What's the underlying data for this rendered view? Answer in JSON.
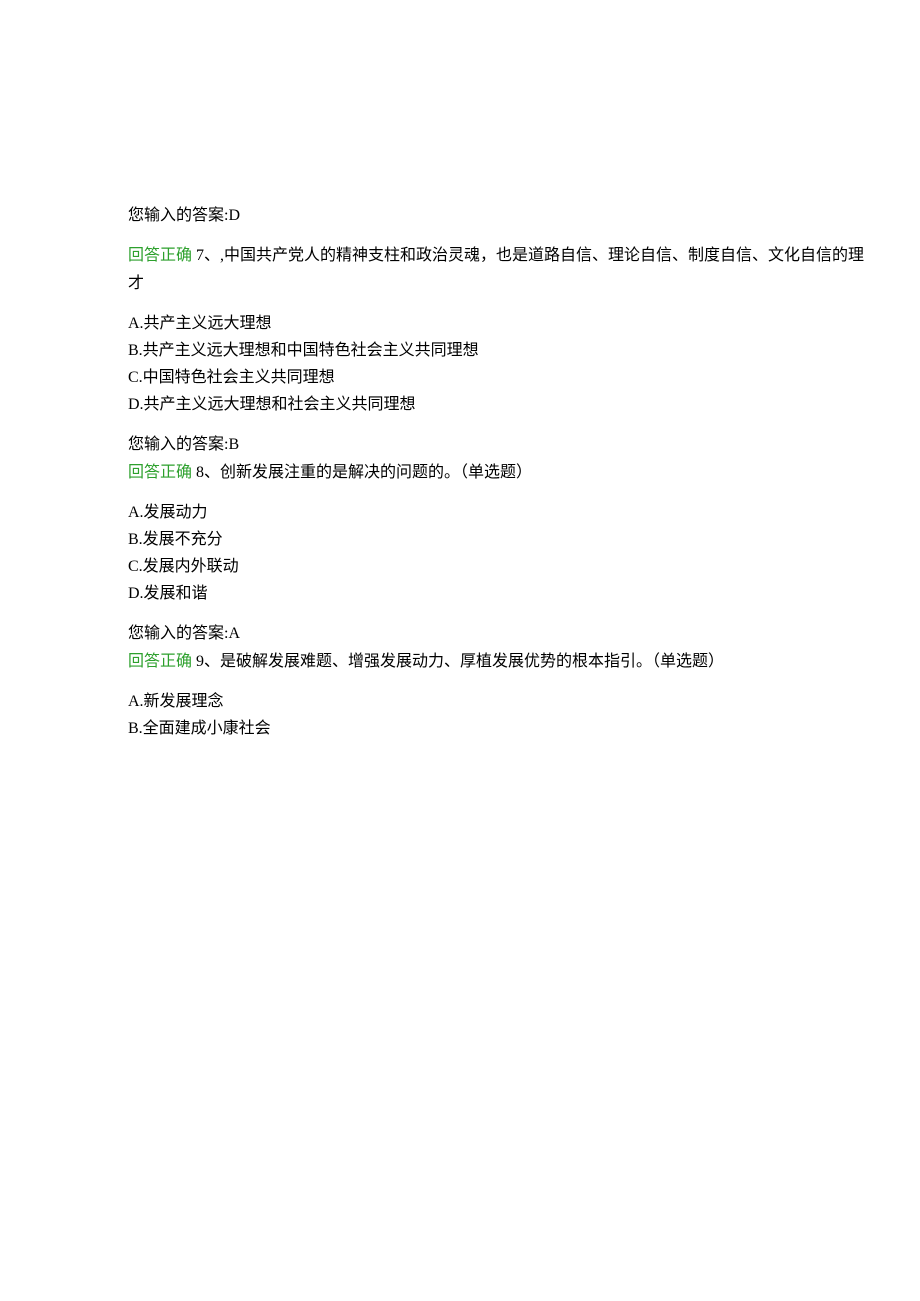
{
  "q6": {
    "your_answer": "您输入的答案:D"
  },
  "q7": {
    "correct_label": "回答正确",
    "stem_part1": " 7、,中国共产党人的精神支柱和政治灵魂，也是道路自信、理论自信、制度自信、文化自信的理",
    "stem_part2": "才",
    "opt_a": "A.共产主义远大理想",
    "opt_b": "B.共产主义远大理想和中国特色社会主义共同理想",
    "opt_c": "C.中国特色社会主义共同理想",
    "opt_d": "D.共产主义远大理想和社会主义共同理想",
    "your_answer": "您输入的答案:B"
  },
  "q8": {
    "correct_label": "回答正确",
    "stem": " 8、创新发展注重的是解决的问题的。（单选题）",
    "opt_a": "A.发展动力",
    "opt_b": "B.发展不充分",
    "opt_c": "C.发展内外联动",
    "opt_d": "D.发展和谐",
    "your_answer": "您输入的答案:A"
  },
  "q9": {
    "correct_label": "回答正确",
    "stem": " 9、是破解发展难题、增强发展动力、厚植发展优势的根本指引。（单选题）",
    "opt_a": "A.新发展理念",
    "opt_b": "B.全面建成小康社会"
  }
}
